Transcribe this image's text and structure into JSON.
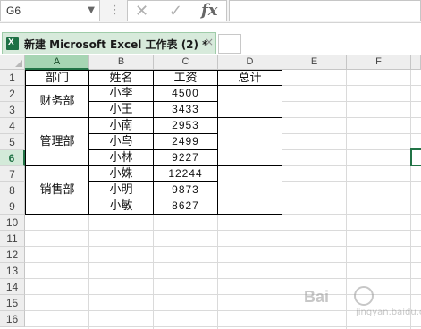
{
  "formula_bar": {
    "name_box": "G6",
    "dropdown_icon": "▼",
    "separator": "⋮",
    "cancel_icon": "✕",
    "enter_icon": "✓",
    "fx_label": "fx"
  },
  "workbook_tab": {
    "icon_letter": "X",
    "title": "新建 Microsoft Excel 工作表 (2) *",
    "close_icon": "×"
  },
  "columns": [
    "A",
    "B",
    "C",
    "D",
    "E",
    "F"
  ],
  "selected_column": "A",
  "rows": [
    "1",
    "2",
    "3",
    "4",
    "5",
    "6",
    "7",
    "8",
    "9",
    "10",
    "11",
    "12",
    "13",
    "14",
    "15",
    "16"
  ],
  "selected_row": "6",
  "table": {
    "headers": [
      "部门",
      "姓名",
      "工资",
      "总计"
    ],
    "departments": [
      "财务部",
      "管理部",
      "销售部"
    ],
    "names": [
      "小李",
      "小王",
      "小南",
      "小鸟",
      "小林",
      "小姝",
      "小明",
      "小敏"
    ],
    "salaries": [
      "4500",
      "3433",
      "2953",
      "2499",
      "9227",
      "12244",
      "9873",
      "8627"
    ]
  },
  "watermark": {
    "brand": "Bai",
    "sub": "jingyan.baidu.com"
  },
  "colors": {
    "accent": "#217346",
    "tab_bg": "#d7eadb",
    "header_selected": "#a6d5b3"
  }
}
